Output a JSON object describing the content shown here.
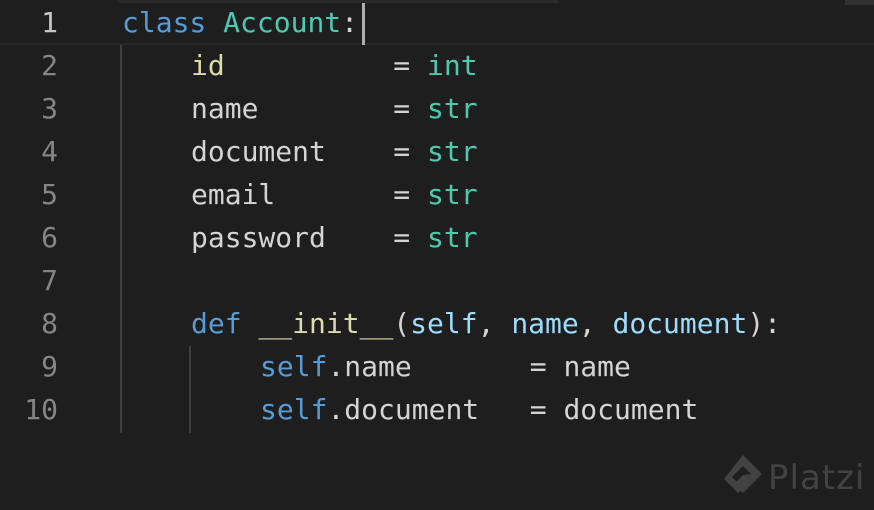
{
  "editor": {
    "language": "python",
    "active_line": 1,
    "lines": [
      {
        "number": "1",
        "tokens": [
          [
            "class",
            "kw"
          ],
          [
            " ",
            "plain"
          ],
          [
            "Account",
            "cls"
          ],
          [
            ":",
            "plain"
          ]
        ]
      },
      {
        "number": "2",
        "tokens": [
          [
            "id",
            "var"
          ],
          [
            "          = ",
            "plain"
          ],
          [
            "int",
            "cls"
          ]
        ]
      },
      {
        "number": "3",
        "tokens": [
          [
            "name",
            "plain"
          ],
          [
            "        = ",
            "plain"
          ],
          [
            "str",
            "cls"
          ]
        ]
      },
      {
        "number": "4",
        "tokens": [
          [
            "document",
            "plain"
          ],
          [
            "    = ",
            "plain"
          ],
          [
            "str",
            "cls"
          ]
        ]
      },
      {
        "number": "5",
        "tokens": [
          [
            "email",
            "plain"
          ],
          [
            "       = ",
            "plain"
          ],
          [
            "str",
            "cls"
          ]
        ]
      },
      {
        "number": "6",
        "tokens": [
          [
            "password",
            "plain"
          ],
          [
            "    = ",
            "plain"
          ],
          [
            "str",
            "cls"
          ]
        ]
      },
      {
        "number": "7",
        "tokens": []
      },
      {
        "number": "8",
        "tokens": [
          [
            "def",
            "kw"
          ],
          [
            " ",
            "plain"
          ],
          [
            "__init__",
            "fn"
          ],
          [
            "(",
            "plain"
          ],
          [
            "self",
            "param"
          ],
          [
            ", ",
            "plain"
          ],
          [
            "name",
            "param"
          ],
          [
            ", ",
            "plain"
          ],
          [
            "document",
            "param"
          ],
          [
            "):",
            "plain"
          ]
        ]
      },
      {
        "number": "9",
        "tokens": [
          [
            "self",
            "self"
          ],
          [
            ".name       = name",
            "plain"
          ]
        ]
      },
      {
        "number": "10",
        "tokens": [
          [
            "self",
            "self"
          ],
          [
            ".document   = document",
            "plain"
          ]
        ]
      }
    ]
  },
  "colors": {
    "background": "#1e1e1e",
    "line_number": "#858585",
    "keyword": "#569cd6",
    "class_name": "#4ec9b0",
    "function": "#dcdcaa",
    "parameter": "#9cdcfe",
    "text": "#d4d4d4"
  },
  "watermark": {
    "text": "Platzi",
    "icon": "platzi-logo-icon"
  }
}
